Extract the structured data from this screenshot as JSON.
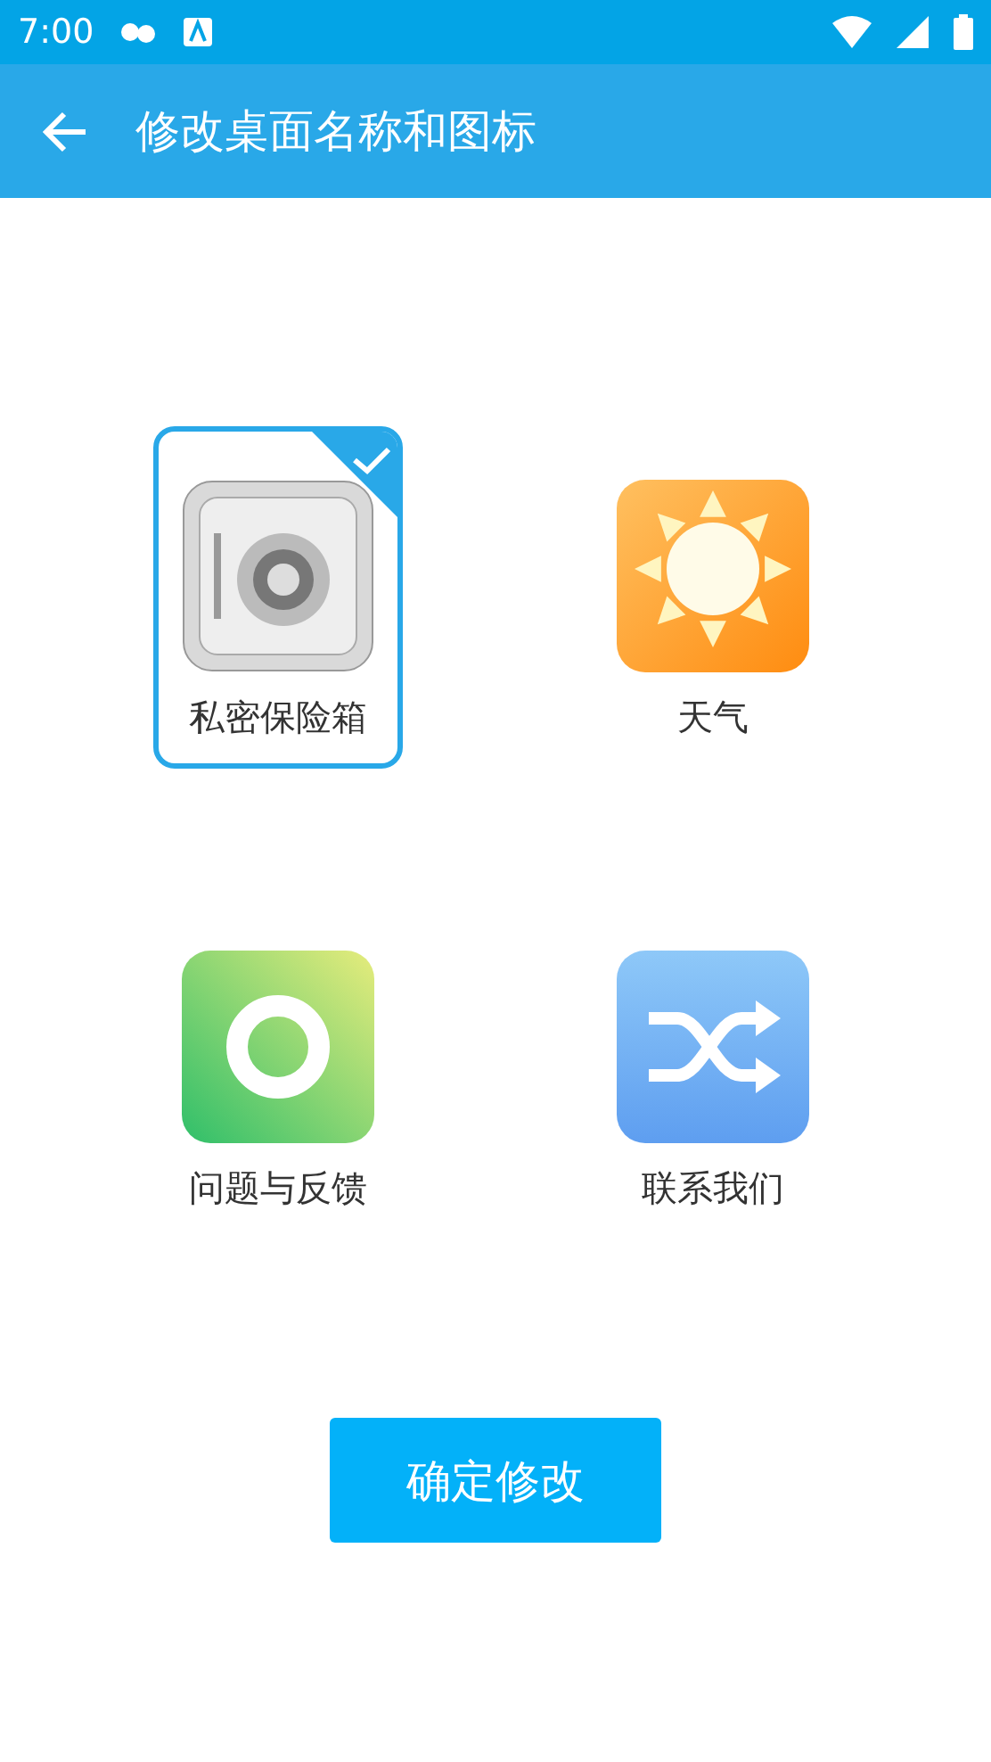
{
  "status_bar": {
    "time": "7:00"
  },
  "app_bar": {
    "title": "修改桌面名称和图标"
  },
  "apps": [
    {
      "kind": "safe",
      "label": "私密保险箱",
      "selected": true
    },
    {
      "kind": "weather",
      "label": "天气",
      "selected": false
    },
    {
      "kind": "ring",
      "label": "问题与反馈",
      "selected": false
    },
    {
      "kind": "shuffle",
      "label": "联系我们",
      "selected": false
    }
  ],
  "confirm_button": "确定修改"
}
